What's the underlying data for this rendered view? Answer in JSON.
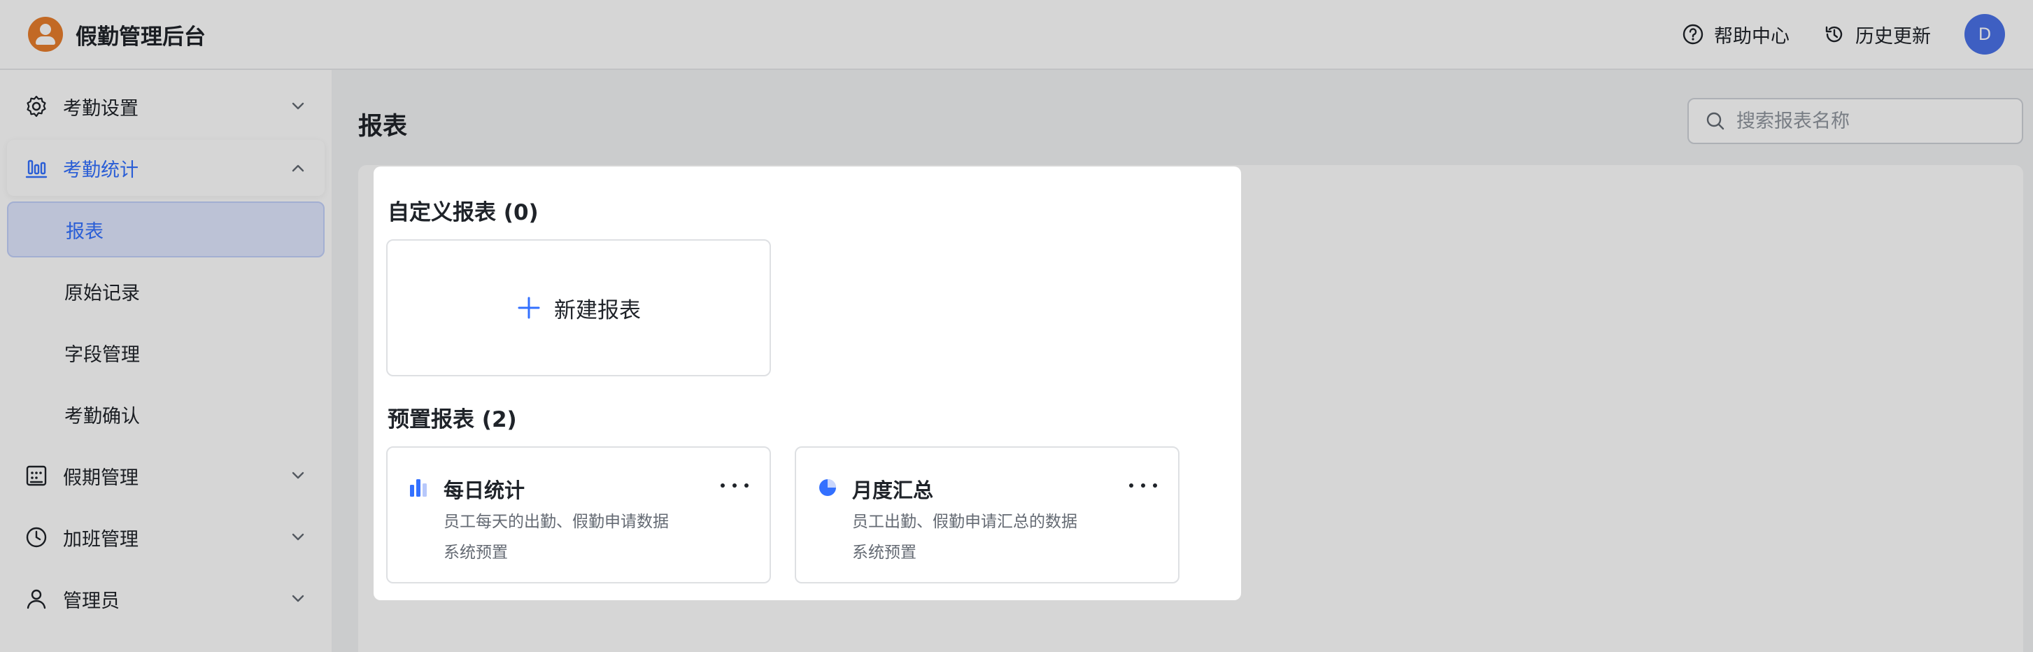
{
  "header": {
    "app_title": "假勤管理后台",
    "help_label": "帮助中心",
    "history_label": "历史更新",
    "avatar_initial": "D",
    "accent_color": "#3370ff"
  },
  "sidebar": {
    "items": [
      {
        "label": "考勤设置",
        "icon": "gear-icon",
        "expanded": false
      },
      {
        "label": "考勤统计",
        "icon": "bar-chart-icon",
        "expanded": true
      },
      {
        "label": "假期管理",
        "icon": "calendar-icon",
        "expanded": false
      },
      {
        "label": "加班管理",
        "icon": "clock-icon",
        "expanded": false
      },
      {
        "label": "管理员",
        "icon": "user-icon",
        "expanded": false
      }
    ],
    "sub_items": [
      {
        "label": "报表",
        "selected": true
      },
      {
        "label": "原始记录",
        "selected": false
      },
      {
        "label": "字段管理",
        "selected": false
      },
      {
        "label": "考勤确认",
        "selected": false
      }
    ]
  },
  "main": {
    "page_title": "报表",
    "search_placeholder": "搜索报表名称"
  },
  "panel": {
    "custom_section_title": "自定义报表 (0)",
    "new_report_label": "新建报表",
    "preset_section_title": "预置报表 (2)",
    "reports": [
      {
        "name": "每日统计",
        "description": "员工每天的出勤、假勤申请数据",
        "tag": "系统预置",
        "icon": "daily-chart-icon"
      },
      {
        "name": "月度汇总",
        "description": "员工出勤、假勤申请汇总的数据",
        "tag": "系统预置",
        "icon": "pie-chart-icon"
      }
    ]
  }
}
